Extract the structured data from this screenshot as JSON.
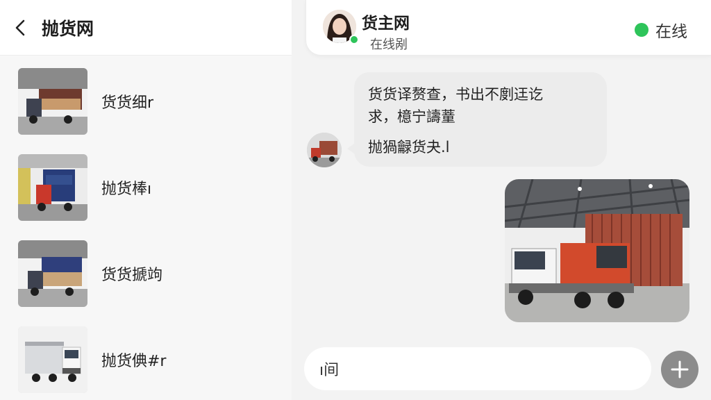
{
  "left": {
    "title": "抛货网",
    "back_icon": "chevron-left-icon",
    "items": [
      {
        "label": "货货细r",
        "image": "warehouse-truck-with-cargo"
      },
      {
        "label": "抛货棒ı",
        "image": "red-truck-with-blue-containers"
      },
      {
        "label": "货货搋竘",
        "image": "warehouse-truck-with-cargo"
      },
      {
        "label": "抛货倎#r",
        "image": "white-cargo-truck"
      }
    ]
  },
  "chat": {
    "contact_name": "货主网",
    "contact_status": "在线剐",
    "online_label": "在线",
    "online_color": "#2ec45a",
    "messages": [
      {
        "type": "text",
        "direction": "incoming",
        "line1": "货货译赘查，书出不剫迋讫",
        "line2": "求，檍宁譸蕫",
        "line3": "抛猧龣货夬.l"
      },
      {
        "type": "image",
        "direction": "outgoing",
        "image": "orange-truck-in-warehouse"
      }
    ],
    "input_value": "ı间",
    "plus_icon": "plus-icon"
  }
}
